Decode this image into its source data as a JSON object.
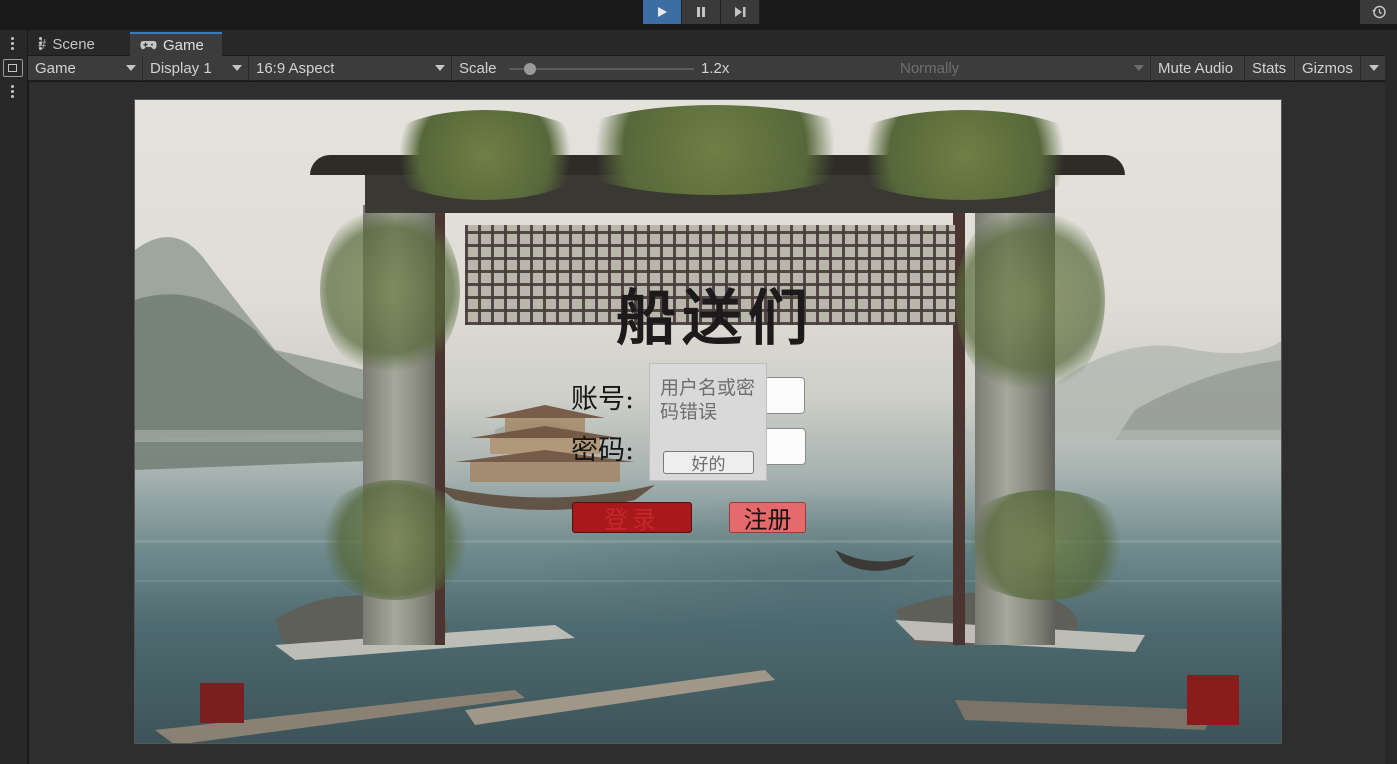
{
  "play_controls": {
    "play_icon": "play-icon",
    "pause_icon": "pause-icon",
    "step_icon": "step-icon",
    "history_icon": "history-icon"
  },
  "tabs": [
    {
      "label": "Scene",
      "icon": "hash-icon"
    },
    {
      "label": "Game",
      "icon": "gamepad-icon"
    }
  ],
  "toolbar": {
    "game_dropdown": "Game",
    "display_dropdown": "Display 1",
    "aspect_dropdown": "16:9 Aspect",
    "scale_label": "Scale",
    "scale_value": "1.2x",
    "play_mode_dropdown": "Normally",
    "mute_audio": "Mute Audio",
    "stats": "Stats",
    "gizmos": "Gizmos"
  },
  "game": {
    "title": "船送们",
    "account_label": "账号:",
    "password_label": "密码:",
    "login_button": "登录",
    "register_button": "注册",
    "dialog": {
      "message": "用户名或密码错误",
      "ok_button": "好的"
    }
  },
  "colors": {
    "accent": "#3d6ea3",
    "tab_highlight": "#3a79bb",
    "login_button": "#a8191c",
    "register_button": "#e66a6c"
  }
}
